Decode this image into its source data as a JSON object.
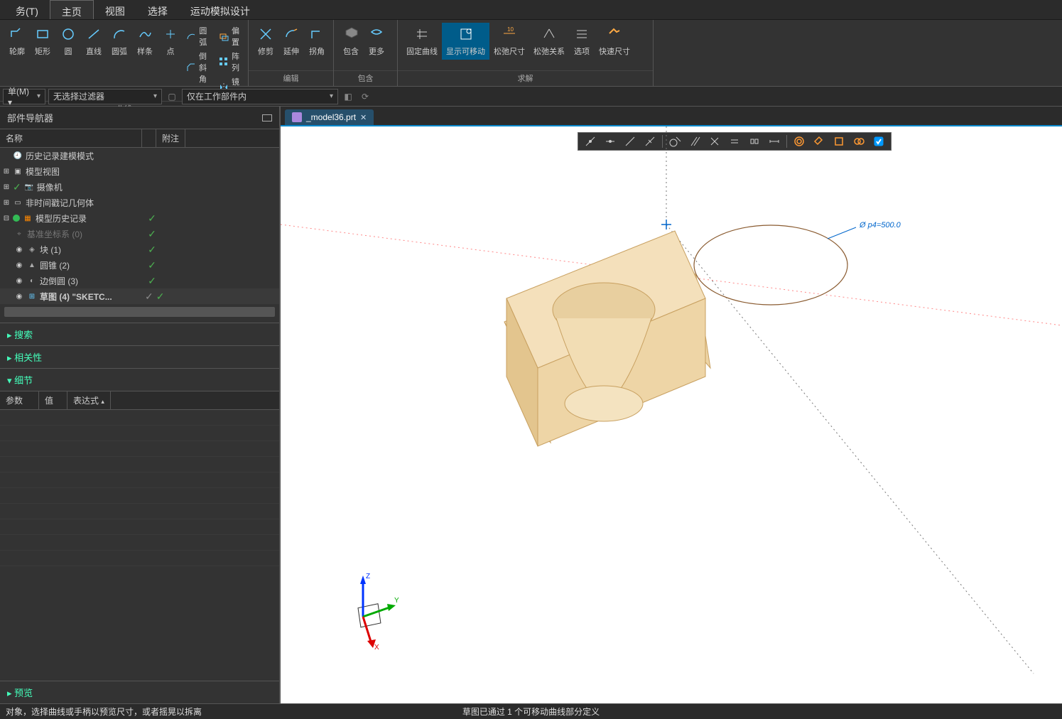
{
  "menu": {
    "task": "务(T)",
    "home": "主页",
    "view": "视图",
    "select": "选择",
    "motion": "运动模拟设计"
  },
  "ribbon": {
    "group_curve": "曲线",
    "group_edit": "编辑",
    "group_include": "包含",
    "group_solve": "求解",
    "profile": "轮廓",
    "rect": "矩形",
    "circle": "圆",
    "line": "直线",
    "arc": "圆弧",
    "spline": "样条",
    "point": "点",
    "arc2": "圆弧",
    "chamfer": "倒斜角",
    "offset": "偏置",
    "array": "阵列",
    "mirror": "镜像",
    "trim": "修剪",
    "extend": "延伸",
    "corner": "拐角",
    "include": "包含",
    "more": "更多",
    "fixed_curve": "固定曲线",
    "show_movable": "显示可移动",
    "relax_dim": "松弛尺寸",
    "relax_rel": "松弛关系",
    "options": "选项",
    "quick_dim": "快速尺寸"
  },
  "filters": {
    "menu": "单(M) ▾",
    "no_sel": "无选择过滤器",
    "work_part": "仅在工作部件内"
  },
  "panel": {
    "title": "部件导航器",
    "col_name": "名称",
    "col_check": " ",
    "col_note": "附注",
    "history_mode": "历史记录建模模式",
    "model_views": "模型视图",
    "cameras": "摄像机",
    "non_ts": "非时间戳记几何体",
    "history": "模型历史记录",
    "datum": "基准坐标系 (0)",
    "block": "块 (1)",
    "cone": "圆锥 (2)",
    "edge_round": "边倒圆 (3)",
    "sketch": "草图 (4) \"SKETC...",
    "search": "搜索",
    "related": "相关性",
    "detail": "细节",
    "preview": "预览",
    "param": "参数",
    "value": "值",
    "expr": "表达式"
  },
  "tab": {
    "file": "_model36.prt"
  },
  "viewport": {
    "dim_label": "Ø p4=500.0",
    "axis_x": "X",
    "axis_y": "Y",
    "axis_z": "Z"
  },
  "status": {
    "left": "对象，选择曲线或手柄以预览尺寸，或者摇晃以拆离",
    "center": "草图已通过 1 个可移动曲线部分定义"
  }
}
